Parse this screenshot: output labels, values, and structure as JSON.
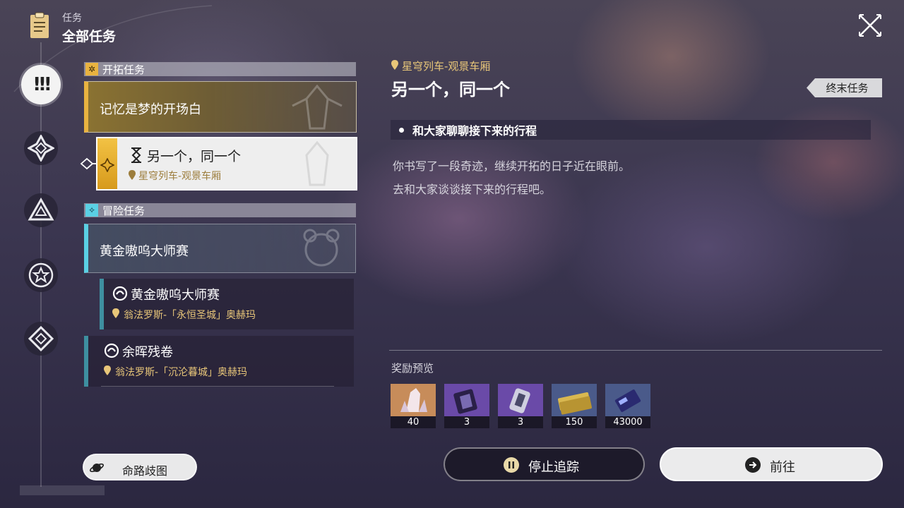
{
  "header": {
    "section_label": "任务",
    "title": "全部任务"
  },
  "sections": {
    "trailblaze": {
      "label": "开拓任务"
    },
    "adventure": {
      "label": "冒险任务"
    }
  },
  "quests": {
    "memory": {
      "title": "记忆是梦的开场白"
    },
    "selected": {
      "title": "另一个，同一个",
      "location": "星穹列车-观景车厢"
    },
    "golden_group": {
      "title": "黄金嗷呜大师赛"
    },
    "golden_sub": {
      "title": "黄金嗷呜大师赛",
      "location": "翁法罗斯-「永恒圣城」奥赫玛"
    },
    "remnant": {
      "title": "余晖残卷",
      "location": "翁法罗斯-「沉沦暮城」奥赫玛"
    }
  },
  "map_button": {
    "label": "命路歧图"
  },
  "detail": {
    "location": "星穹列车-观景车厢",
    "title": "另一个，同一个",
    "tag": "终末任务",
    "objective": "和大家聊聊接下来的行程",
    "description_lines": [
      "你书写了一段奇迹，继续开拓的日子近在眼前。",
      "去和大家谈谈接下来的行程吧。"
    ]
  },
  "rewards": {
    "title": "奖励预览",
    "items": [
      {
        "icon": "crystal-icon",
        "qty": "40",
        "color": "#c78c5a"
      },
      {
        "icon": "fuel-icon",
        "qty": "3",
        "color": "#6a4aa8"
      },
      {
        "icon": "relic-icon",
        "qty": "3",
        "color": "#6a4aa8"
      },
      {
        "icon": "credits-icon",
        "qty": "150",
        "color": "#4a5a8a"
      },
      {
        "icon": "exp-book-icon",
        "qty": "43000",
        "color": "#4a5a8a"
      }
    ]
  },
  "actions": {
    "stop_label": "停止追踪",
    "go_label": "前往"
  },
  "colors": {
    "trailblaze_accent": "#e9b340",
    "adventure_accent": "#5ad0e4",
    "location_gold": "#e8c679"
  }
}
